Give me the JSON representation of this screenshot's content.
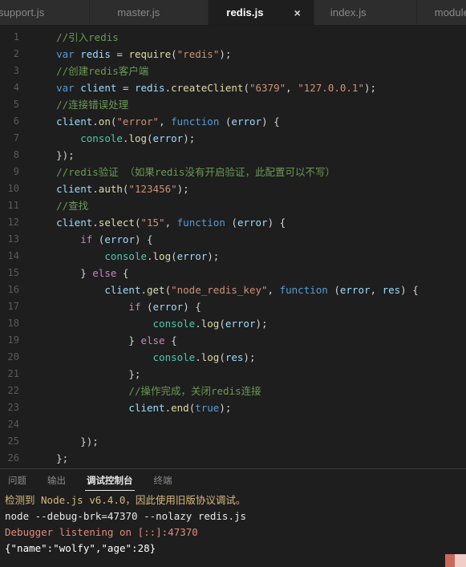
{
  "window": {
    "app": "Visual Studio Code",
    "theme": "dark"
  },
  "tabs": [
    {
      "label": "support.js",
      "active": false,
      "closeable": false
    },
    {
      "label": "master.js",
      "active": false,
      "closeable": false
    },
    {
      "label": "redis.js",
      "active": true,
      "closeable": true,
      "close_glyph": "×"
    },
    {
      "label": "index.js",
      "active": false,
      "closeable": false
    },
    {
      "label": "module.j",
      "active": false,
      "closeable": false
    }
  ],
  "editor": {
    "language": "javascript",
    "lines": [
      {
        "n": "1",
        "segments": [
          {
            "t": "    ",
            "c": "c-pln"
          },
          {
            "t": "//引入redis",
            "c": "c-com"
          }
        ]
      },
      {
        "n": "2",
        "segments": [
          {
            "t": "    ",
            "c": "c-pln"
          },
          {
            "t": "var",
            "c": "c-key"
          },
          {
            "t": " ",
            "c": "c-pln"
          },
          {
            "t": "redis",
            "c": "c-var"
          },
          {
            "t": " = ",
            "c": "c-pln"
          },
          {
            "t": "require",
            "c": "c-fn"
          },
          {
            "t": "(",
            "c": "c-pln"
          },
          {
            "t": "\"redis\"",
            "c": "c-str"
          },
          {
            "t": ");",
            "c": "c-pln"
          }
        ]
      },
      {
        "n": "3",
        "segments": [
          {
            "t": "    ",
            "c": "c-pln"
          },
          {
            "t": "//创建redis客户端",
            "c": "c-com"
          }
        ]
      },
      {
        "n": "4",
        "segments": [
          {
            "t": "    ",
            "c": "c-pln"
          },
          {
            "t": "var",
            "c": "c-key"
          },
          {
            "t": " ",
            "c": "c-pln"
          },
          {
            "t": "client",
            "c": "c-var"
          },
          {
            "t": " = ",
            "c": "c-pln"
          },
          {
            "t": "redis",
            "c": "c-var"
          },
          {
            "t": ".",
            "c": "c-pln"
          },
          {
            "t": "createClient",
            "c": "c-fn"
          },
          {
            "t": "(",
            "c": "c-pln"
          },
          {
            "t": "\"6379\"",
            "c": "c-str"
          },
          {
            "t": ", ",
            "c": "c-pln"
          },
          {
            "t": "\"127.0.0.1\"",
            "c": "c-str"
          },
          {
            "t": ");",
            "c": "c-pln"
          }
        ]
      },
      {
        "n": "5",
        "segments": [
          {
            "t": "    ",
            "c": "c-pln"
          },
          {
            "t": "//连接错误处理",
            "c": "c-com"
          }
        ]
      },
      {
        "n": "6",
        "segments": [
          {
            "t": "    ",
            "c": "c-pln"
          },
          {
            "t": "client",
            "c": "c-var"
          },
          {
            "t": ".",
            "c": "c-pln"
          },
          {
            "t": "on",
            "c": "c-fn"
          },
          {
            "t": "(",
            "c": "c-pln"
          },
          {
            "t": "\"error\"",
            "c": "c-str"
          },
          {
            "t": ", ",
            "c": "c-pln"
          },
          {
            "t": "function",
            "c": "c-key"
          },
          {
            "t": " (",
            "c": "c-pln"
          },
          {
            "t": "error",
            "c": "c-var"
          },
          {
            "t": ") {",
            "c": "c-pln"
          }
        ]
      },
      {
        "n": "7",
        "segments": [
          {
            "t": "        ",
            "c": "c-pln"
          },
          {
            "t": "console",
            "c": "c-obj"
          },
          {
            "t": ".",
            "c": "c-pln"
          },
          {
            "t": "log",
            "c": "c-fn"
          },
          {
            "t": "(",
            "c": "c-pln"
          },
          {
            "t": "error",
            "c": "c-var"
          },
          {
            "t": ");",
            "c": "c-pln"
          }
        ]
      },
      {
        "n": "8",
        "segments": [
          {
            "t": "    });",
            "c": "c-pln"
          }
        ]
      },
      {
        "n": "9",
        "segments": [
          {
            "t": "    ",
            "c": "c-pln"
          },
          {
            "t": "//redis验证 （如果redis没有开启验证，此配置可以不写）",
            "c": "c-com"
          }
        ]
      },
      {
        "n": "10",
        "segments": [
          {
            "t": "    ",
            "c": "c-pln"
          },
          {
            "t": "client",
            "c": "c-var"
          },
          {
            "t": ".",
            "c": "c-pln"
          },
          {
            "t": "auth",
            "c": "c-fn"
          },
          {
            "t": "(",
            "c": "c-pln"
          },
          {
            "t": "\"123456\"",
            "c": "c-str"
          },
          {
            "t": ");",
            "c": "c-pln"
          }
        ]
      },
      {
        "n": "11",
        "segments": [
          {
            "t": "    ",
            "c": "c-pln"
          },
          {
            "t": "//查找",
            "c": "c-com"
          }
        ]
      },
      {
        "n": "12",
        "segments": [
          {
            "t": "    ",
            "c": "c-pln"
          },
          {
            "t": "client",
            "c": "c-var"
          },
          {
            "t": ".",
            "c": "c-pln"
          },
          {
            "t": "select",
            "c": "c-fn"
          },
          {
            "t": "(",
            "c": "c-pln"
          },
          {
            "t": "\"15\"",
            "c": "c-str"
          },
          {
            "t": ", ",
            "c": "c-pln"
          },
          {
            "t": "function",
            "c": "c-key"
          },
          {
            "t": " (",
            "c": "c-pln"
          },
          {
            "t": "error",
            "c": "c-var"
          },
          {
            "t": ") {",
            "c": "c-pln"
          }
        ]
      },
      {
        "n": "13",
        "segments": [
          {
            "t": "        ",
            "c": "c-pln"
          },
          {
            "t": "if",
            "c": "c-kw2"
          },
          {
            "t": " (",
            "c": "c-pln"
          },
          {
            "t": "error",
            "c": "c-var"
          },
          {
            "t": ") {",
            "c": "c-pln"
          }
        ]
      },
      {
        "n": "14",
        "segments": [
          {
            "t": "            ",
            "c": "c-pln"
          },
          {
            "t": "console",
            "c": "c-obj"
          },
          {
            "t": ".",
            "c": "c-pln"
          },
          {
            "t": "log",
            "c": "c-fn"
          },
          {
            "t": "(",
            "c": "c-pln"
          },
          {
            "t": "error",
            "c": "c-var"
          },
          {
            "t": ");",
            "c": "c-pln"
          }
        ]
      },
      {
        "n": "15",
        "segments": [
          {
            "t": "        } ",
            "c": "c-pln"
          },
          {
            "t": "else",
            "c": "c-kw2"
          },
          {
            "t": " {",
            "c": "c-pln"
          }
        ]
      },
      {
        "n": "16",
        "segments": [
          {
            "t": "            ",
            "c": "c-pln"
          },
          {
            "t": "client",
            "c": "c-var"
          },
          {
            "t": ".",
            "c": "c-pln"
          },
          {
            "t": "get",
            "c": "c-fn"
          },
          {
            "t": "(",
            "c": "c-pln"
          },
          {
            "t": "\"node_redis_key\"",
            "c": "c-str"
          },
          {
            "t": ", ",
            "c": "c-pln"
          },
          {
            "t": "function",
            "c": "c-key"
          },
          {
            "t": " (",
            "c": "c-pln"
          },
          {
            "t": "error",
            "c": "c-var"
          },
          {
            "t": ", ",
            "c": "c-pln"
          },
          {
            "t": "res",
            "c": "c-var"
          },
          {
            "t": ") {",
            "c": "c-pln"
          }
        ]
      },
      {
        "n": "17",
        "segments": [
          {
            "t": "                ",
            "c": "c-pln"
          },
          {
            "t": "if",
            "c": "c-kw2"
          },
          {
            "t": " (",
            "c": "c-pln"
          },
          {
            "t": "error",
            "c": "c-var"
          },
          {
            "t": ") {",
            "c": "c-pln"
          }
        ]
      },
      {
        "n": "18",
        "segments": [
          {
            "t": "                    ",
            "c": "c-pln"
          },
          {
            "t": "console",
            "c": "c-obj"
          },
          {
            "t": ".",
            "c": "c-pln"
          },
          {
            "t": "log",
            "c": "c-fn"
          },
          {
            "t": "(",
            "c": "c-pln"
          },
          {
            "t": "error",
            "c": "c-var"
          },
          {
            "t": ");",
            "c": "c-pln"
          }
        ]
      },
      {
        "n": "19",
        "segments": [
          {
            "t": "                } ",
            "c": "c-pln"
          },
          {
            "t": "else",
            "c": "c-kw2"
          },
          {
            "t": " {",
            "c": "c-pln"
          }
        ]
      },
      {
        "n": "20",
        "segments": [
          {
            "t": "                    ",
            "c": "c-pln"
          },
          {
            "t": "console",
            "c": "c-obj"
          },
          {
            "t": ".",
            "c": "c-pln"
          },
          {
            "t": "log",
            "c": "c-fn"
          },
          {
            "t": "(",
            "c": "c-pln"
          },
          {
            "t": "res",
            "c": "c-var"
          },
          {
            "t": ");",
            "c": "c-pln"
          }
        ]
      },
      {
        "n": "21",
        "segments": [
          {
            "t": "                };",
            "c": "c-pln"
          }
        ]
      },
      {
        "n": "22",
        "segments": [
          {
            "t": "                ",
            "c": "c-pln"
          },
          {
            "t": "//操作完成，关闭redis连接",
            "c": "c-com"
          }
        ]
      },
      {
        "n": "23",
        "segments": [
          {
            "t": "                ",
            "c": "c-pln"
          },
          {
            "t": "client",
            "c": "c-var"
          },
          {
            "t": ".",
            "c": "c-pln"
          },
          {
            "t": "end",
            "c": "c-fn"
          },
          {
            "t": "(",
            "c": "c-pln"
          },
          {
            "t": "true",
            "c": "c-bool"
          },
          {
            "t": ");",
            "c": "c-pln"
          }
        ]
      },
      {
        "n": "24",
        "segments": [
          {
            "t": "",
            "c": "c-pln"
          }
        ]
      },
      {
        "n": "25",
        "segments": [
          {
            "t": "        });",
            "c": "c-pln"
          }
        ]
      },
      {
        "n": "26",
        "segments": [
          {
            "t": "    };",
            "c": "c-pln"
          }
        ]
      }
    ]
  },
  "panel": {
    "tabs": [
      {
        "label": "问题",
        "active": false
      },
      {
        "label": "输出",
        "active": false
      },
      {
        "label": "调试控制台",
        "active": true
      },
      {
        "label": "终端",
        "active": false
      }
    ],
    "console_lines": [
      {
        "text": "检测到 Node.js v6.4.0，因此使用旧版协议调试。",
        "c": "cl-warn"
      },
      {
        "text": "node --debug-brk=47370 --nolazy redis.js",
        "c": "cl-cmd"
      },
      {
        "text": "Debugger listening on [::]:47370",
        "c": "cl-err"
      },
      {
        "text": "{\"name\":\"wolfy\",\"age\":28}",
        "c": "cl-out"
      }
    ]
  },
  "colors": {
    "editor_bg": "#1e1e1e",
    "tabbar_bg": "#252526",
    "inactive_tab_bg": "#2d2d2d",
    "comment": "#6A9955",
    "keyword": "#569CD6",
    "string": "#CE9178",
    "function": "#DCDCAA",
    "variable": "#9CDCFE",
    "console_warn": "#d7ba7d",
    "console_error": "#e08b7a"
  }
}
